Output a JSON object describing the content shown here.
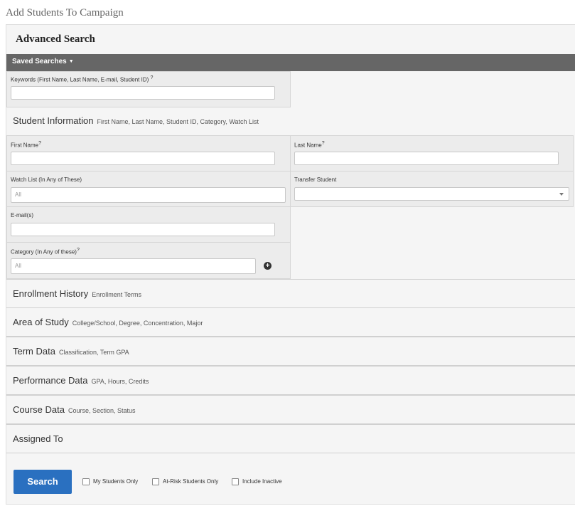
{
  "page": {
    "title": "Add Students To Campaign"
  },
  "advanced_search": {
    "title": "Advanced Search",
    "saved_searches_label": "Saved Searches",
    "keywords": {
      "label": "Keywords (First Name, Last Name, E-mail, Student ID)",
      "help": "?",
      "value": ""
    }
  },
  "student_info": {
    "title": "Student Information",
    "subtitle": "First Name, Last Name, Student ID, Category, Watch List",
    "first_name": {
      "label": "First Name",
      "help": "?",
      "value": ""
    },
    "last_name": {
      "label": "Last Name",
      "help": "?",
      "value": ""
    },
    "watch_list": {
      "label": "Watch List (In Any of These)",
      "placeholder": "All"
    },
    "transfer_student": {
      "label": "Transfer Student",
      "value": ""
    },
    "email": {
      "label": "E-mail(s)",
      "value": ""
    },
    "category": {
      "label": "Category (In Any of these)",
      "help": "?",
      "placeholder": "All"
    }
  },
  "sections": [
    {
      "title": "Enrollment History",
      "subtitle": "Enrollment Terms"
    },
    {
      "title": "Area of Study",
      "subtitle": "College/School, Degree, Concentration, Major"
    },
    {
      "title": "Term Data",
      "subtitle": "Classification, Term GPA"
    },
    {
      "title": "Performance Data",
      "subtitle": "GPA, Hours, Credits"
    },
    {
      "title": "Course Data",
      "subtitle": "Course, Section, Status"
    },
    {
      "title": "Assigned To",
      "subtitle": ""
    }
  ],
  "footer": {
    "search_label": "Search",
    "checkboxes": [
      {
        "label": "My Students Only",
        "checked": false
      },
      {
        "label": "At-Risk Students Only",
        "checked": false
      },
      {
        "label": "Include Inactive",
        "checked": false
      }
    ]
  },
  "colors": {
    "accent": "#2a70c0",
    "bar": "#666666"
  },
  "icons": {
    "add": "plus-circle-icon",
    "dropdown": "caret-down-icon"
  }
}
